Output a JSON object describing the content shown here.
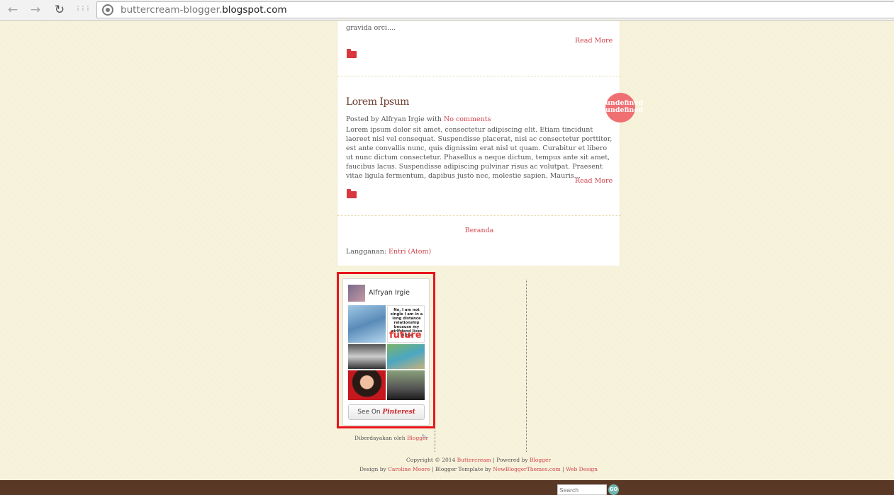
{
  "browser": {
    "url_prefix": "buttercream-blogger.",
    "url_domain": "blogspot.com",
    "back_icon": "←",
    "forward_icon": "→",
    "reload_icon": "↻",
    "apps_icon": "⋮⋮⋮"
  },
  "prev_post": {
    "text_tail": "gravida orci....",
    "read_more": "Read More"
  },
  "post": {
    "title": "Lorem Ipsum",
    "byline_prefix": "Posted by Alfryan Irgie with ",
    "comments_link": "No comments",
    "excerpt": "Lorem ipsum dolor sit amet, consectetur adipiscing elit. Etiam tincidunt laoreet nisl vel consequat. Suspendisse placerat, nisi ac consectetur porttitor, est ante convallis nunc, quis dignissim erat nisl ut quam. Curabitur et libero ut nunc dictum consectetur. Phasellus a neque dictum, tempus ante sit amet, faucibus lacus. Suspendisse adipiscing pulvinar risus ac volutpat. Praesent vitae ligula fermentum, dapibus justo nec, molestie sapien. Mauris...",
    "read_more": "Read More",
    "badge_line1": "undefined",
    "badge_line2": "undefined"
  },
  "pager": {
    "home_link": "Beranda",
    "subscribe_label": "Langganan: ",
    "subscribe_link": "Entri (Atom)"
  },
  "pinterest": {
    "user_name": "Alfryan Irgie",
    "quote_text": "No, I am not single I am in a long distance relationship because my girlfriend lives in the",
    "quote_highlight": "future",
    "see_on": "See On ",
    "brand": "Pinterest"
  },
  "powered_by": {
    "prefix": "Diberdayakan oleh ",
    "link": "Blogger"
  },
  "footer": {
    "line1_prefix": "Copyright © 2014 ",
    "line1_link1": "Buttercream",
    "line1_mid": " | Powered by ",
    "line1_link2": "Blogger",
    "line2_prefix": "Design by ",
    "line2_link1": "Caroline Moore",
    "line2_mid1": " | Blogger Template by ",
    "line2_link2": "NewBloggerThemes.com",
    "line2_mid2": " | ",
    "line2_link3": "Web Design"
  },
  "bottom_bar": {
    "search_placeholder": "Search",
    "search_button": "GO"
  }
}
